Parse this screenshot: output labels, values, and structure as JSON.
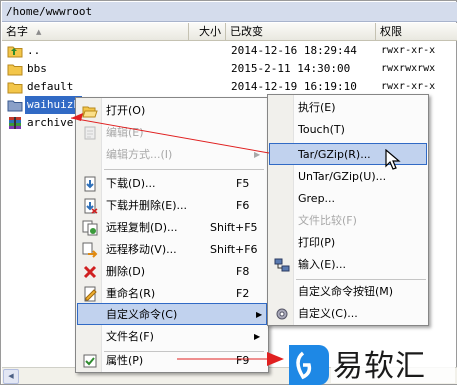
{
  "path": "/home/wwwroot",
  "columns": {
    "name": "名字",
    "size": "大小",
    "modified": "已改变",
    "permissions": "权限"
  },
  "files": [
    {
      "name": "..",
      "date": "2014-12-16 18:29:44",
      "perm": "rwxr-xr-x",
      "icon": "folder-up-icon"
    },
    {
      "name": "bbs",
      "date": "2015-2-11 14:30:00",
      "perm": "rwxrwxrwx",
      "icon": "folder-icon"
    },
    {
      "name": "default",
      "date": "2014-12-19 16:19:10",
      "perm": "rwxr-xr-x",
      "icon": "folder-icon"
    },
    {
      "name": "waihuizh",
      "date": "",
      "perm": "",
      "icon": "folder-icon"
    },
    {
      "name": "archive.",
      "date": "",
      "perm": "",
      "icon": "archive-icon"
    }
  ],
  "context_menu": {
    "open": "打开(O)",
    "edit": "编辑(E)",
    "edit_with": "编辑方式...(I)",
    "download": "下载(D)...",
    "download_shortcut": "F5",
    "download_delete": "下载并删除(E)...",
    "download_delete_shortcut": "F6",
    "remote_copy": "远程复制(D)...",
    "remote_copy_shortcut": "Shift+F5",
    "remote_move": "远程移动(V)...",
    "remote_move_shortcut": "Shift+F6",
    "delete": "删除(D)",
    "delete_shortcut": "F8",
    "rename": "重命名(R)",
    "rename_shortcut": "F2",
    "custom_commands": "自定义命令(C)",
    "file_names": "文件名(F)",
    "properties": "属性(P)",
    "properties_shortcut": "F9"
  },
  "submenu": {
    "execute": "执行(E)",
    "touch": "Touch(T)",
    "tar_gzip": "Tar/GZip(R)...",
    "untar": "UnTar/GZip(U)...",
    "grep": "Grep...",
    "file_compare": "文件比较(F)",
    "print": "打印(P)",
    "input": "输入(E)...",
    "custom_buttons": "自定义命令按钮(M)",
    "customize": "自定义(C)..."
  },
  "watermark": "易软汇",
  "colors": {
    "highlight": "#c1d2ee",
    "highlight_border": "#316ac5",
    "arrow_red": "#e02020",
    "logo_blue": "#1e88e5"
  }
}
